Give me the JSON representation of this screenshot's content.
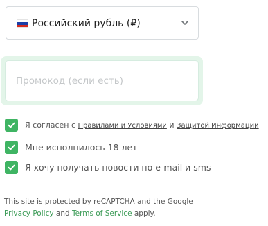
{
  "currency": {
    "selected_label": "Российский рубль (₽)",
    "flag_icon": "russia-flag-icon",
    "chevron_icon": "chevron-down-icon"
  },
  "promo": {
    "placeholder": "Промокод (если есть)",
    "value": ""
  },
  "checkboxes": [
    {
      "checked": true,
      "text_prefix": "Я согласен с ",
      "link1": "Правилами и Условиями",
      "text_mid": " и ",
      "link2": "Защитой Информации"
    },
    {
      "checked": true,
      "text": "Мне исполнилось 18 лет"
    },
    {
      "checked": true,
      "text": "Я хочу получать новости по e-mail и sms"
    }
  ],
  "recaptcha": {
    "text_prefix": "This site is protected by reCAPTCHA and the Google",
    "privacy_link": "Privacy Policy",
    "and_text": " and ",
    "terms_link": "Terms of Service",
    "suffix": " apply."
  },
  "colors": {
    "accent_green": "#3fb463",
    "promo_glow": "#e3f5e9",
    "link_green": "#3a9a55"
  }
}
